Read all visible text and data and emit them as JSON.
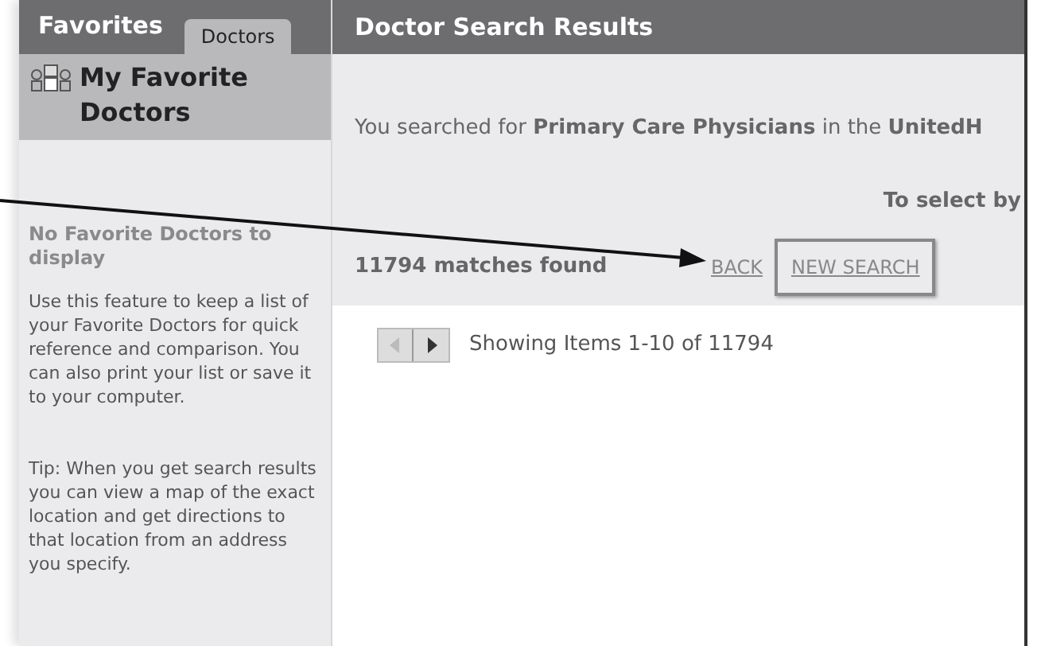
{
  "sidebar": {
    "title": "Favorites",
    "tabs": [
      {
        "label": "Doctors",
        "selected": true
      }
    ],
    "section_title": "My Favorite Doctors",
    "empty_title": "No Favorite Doctors to display",
    "paragraphs": [
      "Use this feature to keep a list of your Favorite Doctors for quick reference and comparison. You can also print your list or save it to your computer.",
      "Tip: When you get search results you can view a map of the exact location and get directions to that location from an address you specify."
    ]
  },
  "main": {
    "title": "Doctor Search Results",
    "search_summary": "You searched for **Primary Care Physicians** in the **UnitedH**",
    "select_hint": "To select by",
    "matches": "11794 matches found",
    "back_link": "BACK",
    "new_search_button": "NEW SEARCH",
    "pager": {
      "prev_disabled": true,
      "next_disabled": false,
      "status": "Showing Items 1-10 of 11794"
    }
  }
}
